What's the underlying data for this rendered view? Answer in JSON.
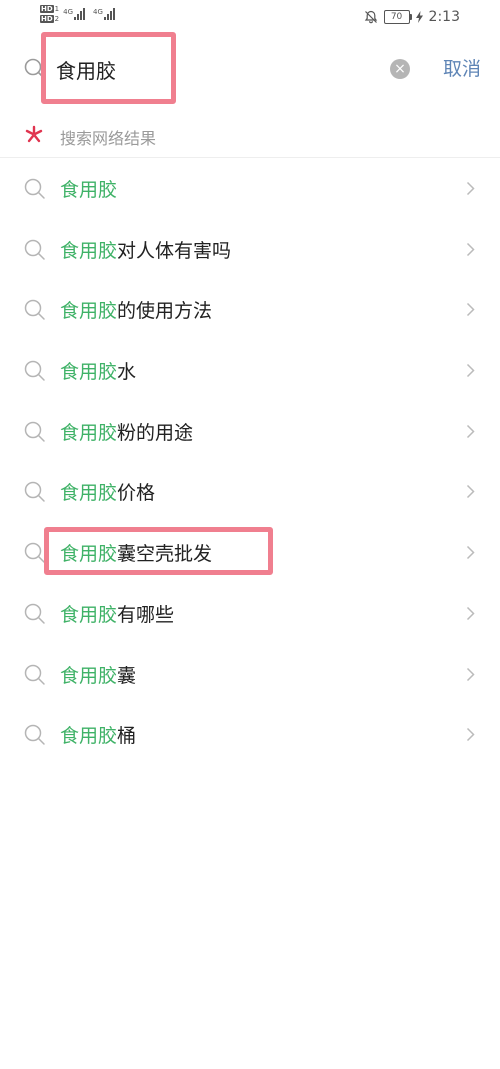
{
  "status_bar": {
    "hd1": "HD",
    "hd1_num": "1",
    "hd2": "HD",
    "hd2_num": "2",
    "net1": "4G",
    "net2": "4G",
    "battery": "70",
    "time": "2:13"
  },
  "search": {
    "query": "食用胶",
    "cancel_label": "取消",
    "clear_symbol": "×"
  },
  "section": {
    "title": "搜索网络结果"
  },
  "suggestions": [
    {
      "keyword": "食用胶",
      "rest": ""
    },
    {
      "keyword": "食用胶",
      "rest": "对人体有害吗"
    },
    {
      "keyword": "食用胶",
      "rest": "的使用方法"
    },
    {
      "keyword": "食用胶",
      "rest": "水"
    },
    {
      "keyword": "食用胶",
      "rest": "粉的用途"
    },
    {
      "keyword": "食用胶",
      "rest": "价格"
    },
    {
      "keyword": "食用胶",
      "rest": "囊空壳批发"
    },
    {
      "keyword": "食用胶",
      "rest": "有哪些"
    },
    {
      "keyword": "食用胶",
      "rest": "囊"
    },
    {
      "keyword": "食用胶",
      "rest": "桶"
    }
  ],
  "colors": {
    "keyword": "#3fb267",
    "cancel": "#5f85b6",
    "highlight": "#f07f8f",
    "spark": "#e0344f"
  }
}
